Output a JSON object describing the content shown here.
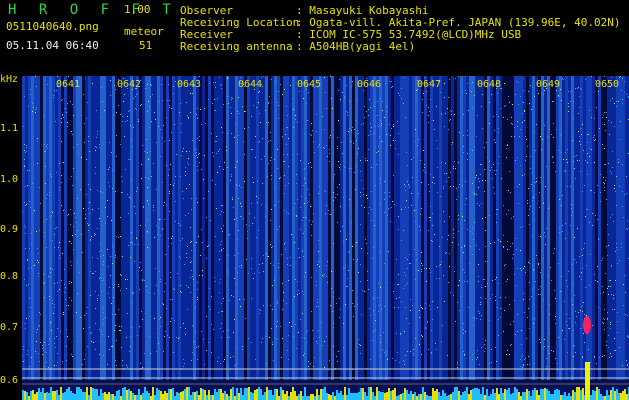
{
  "header": {
    "app_title": "H R O F F T",
    "app_version": "1.00",
    "file_name": "0511040640.png",
    "datetime": "05.11.04 06:40",
    "mode_label": "meteor",
    "mode_value": "51",
    "info": [
      {
        "label": "Observer",
        "value": ": Masayuki Kobayashi"
      },
      {
        "label": "Receiving Location",
        "value": ": Ogata-vill. Akita-Pref. JAPAN (139.96E, 40.02N)"
      },
      {
        "label": "Receiver",
        "value": ": ICOM IC-575 53.7492(@LCD)MHz USB"
      },
      {
        "label": "Receiving antenna",
        "value": ": A504HB(yagi 4el)"
      }
    ]
  },
  "axis": {
    "unit": "kHz",
    "y_ticks": [
      "1.1",
      "1.0",
      "0.9",
      "0.8",
      "0.7",
      "0.6"
    ],
    "x_ticks": [
      "0641",
      "0642",
      "0643",
      "0644",
      "0645",
      "0646",
      "0647",
      "0648",
      "0649",
      "0650"
    ]
  },
  "colors": {
    "background": "#000000",
    "label_yellow": "#e8e000",
    "label_green": "#2fd24a",
    "spectrogram_base": "#001060",
    "meteor_echo": "#ff2060"
  }
}
